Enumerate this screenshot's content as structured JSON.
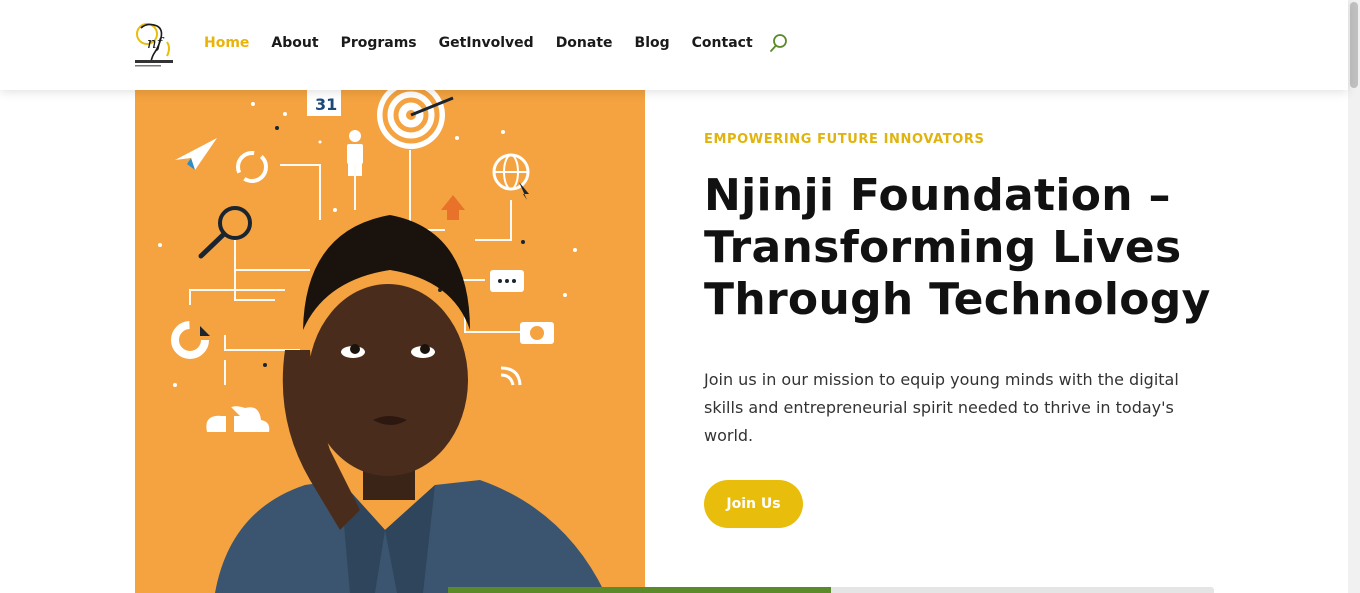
{
  "header": {
    "logo_alt": "Njinji Foundation",
    "nav": [
      {
        "label": "Home",
        "active": true
      },
      {
        "label": "About",
        "active": false
      },
      {
        "label": "Programs",
        "active": false
      },
      {
        "label": "GetInvolved",
        "active": false
      },
      {
        "label": "Donate",
        "active": false
      },
      {
        "label": "Blog",
        "active": false
      },
      {
        "label": "Contact",
        "active": false
      }
    ],
    "search_icon": "search-icon"
  },
  "hero": {
    "eyebrow": "EMPOWERING FUTURE INNOVATORS",
    "title": "Njinji Foundation – Transforming Lives Through Technology",
    "description": "Join us in our mission to equip young minds with the digital skills and entrepreneurial spirit needed to thrive in today's world.",
    "cta_label": "Join Us",
    "image_calendar_text": "31"
  },
  "slider": {
    "progress": 0.5
  },
  "colors": {
    "accent": "#e8bd0b",
    "nav_active": "#eab308",
    "hero_bg": "#f4a340",
    "progress": "#5a8a2a"
  }
}
